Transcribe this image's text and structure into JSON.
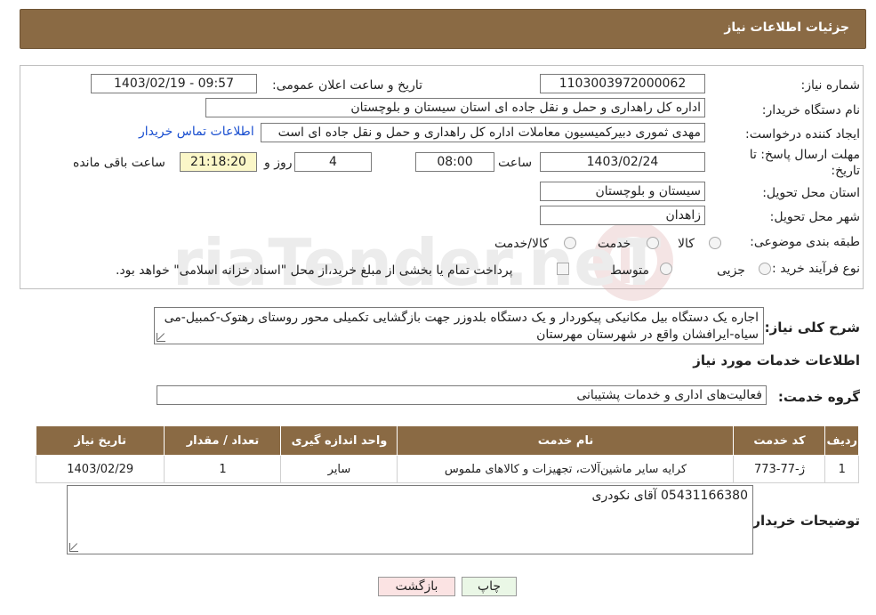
{
  "header": {
    "title": "جزئیات اطلاعات نیاز"
  },
  "form": {
    "need_number_label": "شماره نیاز:",
    "need_number": "1103003972000062",
    "announce_label": "تاریخ و ساعت اعلان عمومی:",
    "announce_value": "1403/02/19 - 09:57",
    "buyer_org_label": "نام دستگاه خریدار:",
    "buyer_org": "اداره کل راهداری و حمل و نقل جاده ای استان سیستان و بلوچستان",
    "creator_label": "ایجاد کننده درخواست:",
    "creator": "مهدی ثموری دبیرکمیسیون معاملات اداره کل راهداری و حمل و نقل جاده ای است",
    "contact_link": "اطلاعات تماس خریدار",
    "deadline_label_1": "مهلت ارسال پاسخ: تا",
    "deadline_label_2": "تاریخ:",
    "deadline_date": "1403/02/24",
    "time_label": "ساعت",
    "deadline_time": "08:00",
    "days_value": "4",
    "days_label": "روز و",
    "remaining_time": "21:18:20",
    "remaining_label": "ساعت باقی مانده",
    "province_label": "استان محل تحویل:",
    "province": "سیستان و بلوچستان",
    "city_label": "شهر محل تحویل:",
    "city": "زاهدان",
    "category_label": "طبقه بندی موضوعی:",
    "category_options": [
      "کالا",
      "خدمت",
      "کالا/خدمت"
    ],
    "purchase_type_label": "نوع فرآیند خرید :",
    "purchase_options": [
      "جزیی",
      "متوسط"
    ],
    "treasury_note": "پرداخت تمام یا بخشی از مبلغ خرید،از محل \"اسناد خزانه اسلامی\" خواهد بود."
  },
  "description": {
    "label": "شرح کلی نیاز:",
    "text": "اجاره یک دستگاه بیل مکانیکی پیکوردار و یک دستگاه بلدوزر جهت بازگشایی تکمیلی محور روستای رهتوک-کمبیل-می سیاه-ایرافشان واقع در شهرستان مهرستان"
  },
  "services": {
    "section_title": "اطلاعات خدمات مورد نیاز",
    "group_label": "گروه خدمت:",
    "group_value": "فعالیت‌های اداری و خدمات پشتیبانی",
    "columns": [
      "ردیف",
      "کد خدمت",
      "نام خدمت",
      "واحد اندازه گیری",
      "تعداد / مقدار",
      "تاریخ نیاز"
    ],
    "rows": [
      [
        "1",
        "ژ-77-773",
        "کرایه سایر ماشین‌آلات، تجهیزات و کالاهای ملموس",
        "سایر",
        "1",
        "1403/02/29"
      ]
    ]
  },
  "buyer_notes": {
    "label": "توضیحات خریدار:",
    "text": "05431166380 آقای نکودری"
  },
  "buttons": {
    "print": "چاپ",
    "back": "بازگشت"
  },
  "watermark": {
    "text": "AriaTender.neT"
  },
  "colors": {
    "header_bg": "#8a6a44",
    "link": "#1a4fd0",
    "back_button_bg": "#fbe3e3",
    "print_button_bg": "#eaf7e6"
  }
}
